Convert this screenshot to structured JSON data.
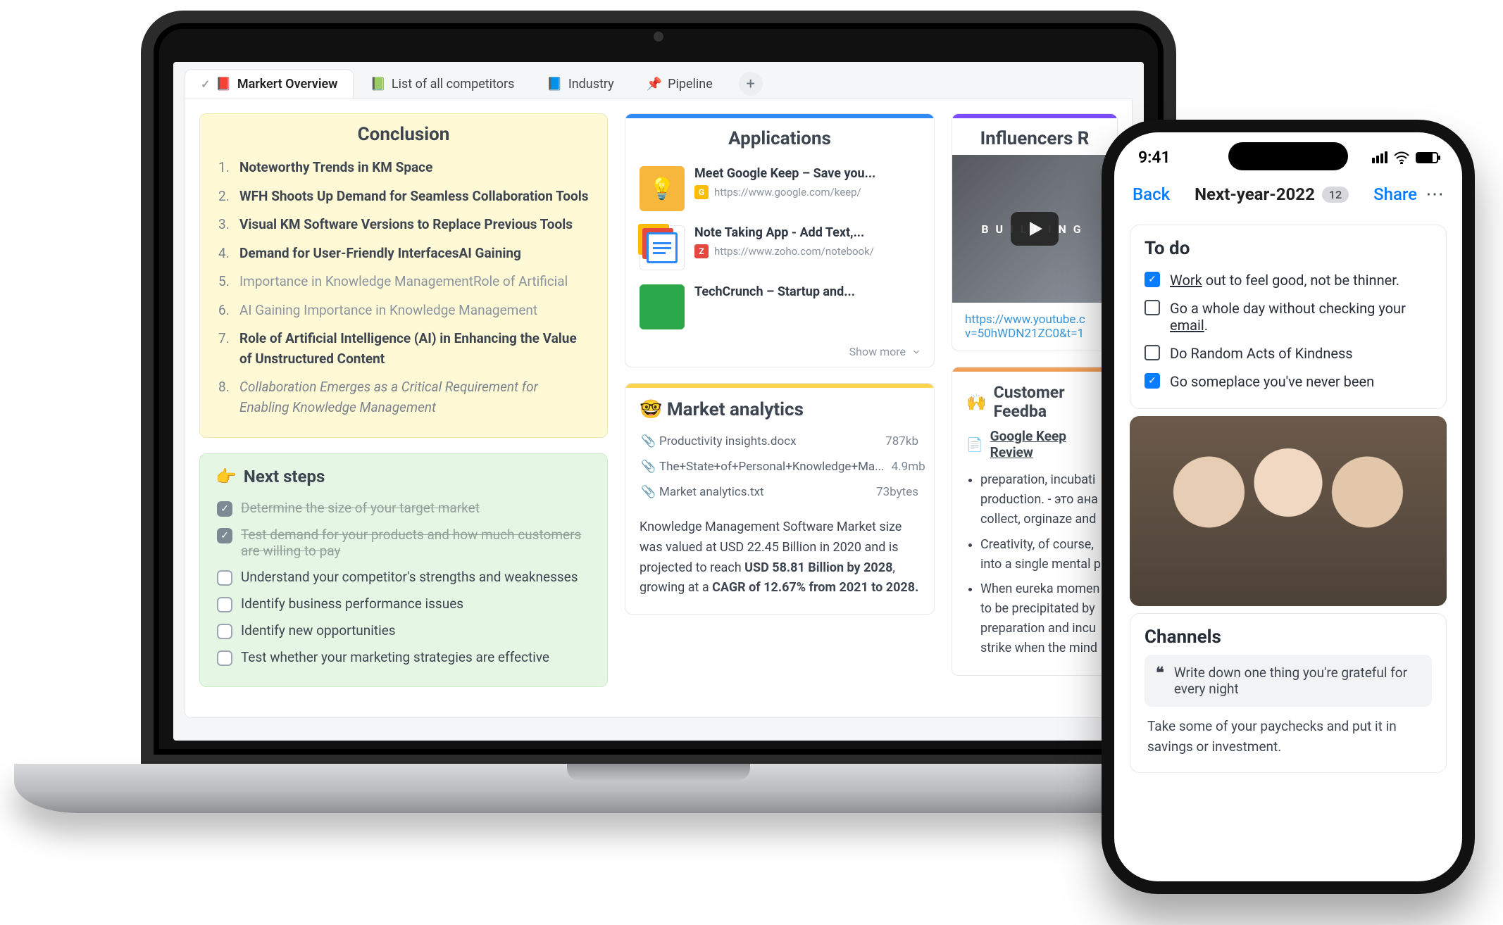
{
  "tabs": [
    {
      "emoji": "📕",
      "label": "Markert Overview",
      "active": true
    },
    {
      "emoji": "📗",
      "label": "List of all competitors"
    },
    {
      "emoji": "📘",
      "label": "Industry"
    },
    {
      "emoji": "📌",
      "label": "Pipeline"
    }
  ],
  "conclusion": {
    "title": "Conclusion",
    "items": [
      {
        "text": "Noteworthy Trends in KM Space",
        "style": "bold"
      },
      {
        "text": "WFH Shoots Up Demand for Seamless Collaboration Tools",
        "style": "bold"
      },
      {
        "text": "Visual KM Software Versions to Replace Previous Tools",
        "style": "bold"
      },
      {
        "text": "Demand for User-Friendly InterfacesAI Gaining",
        "style": "bold"
      },
      {
        "text": "Importance in Knowledge ManagementRole of Artificial",
        "style": "muted"
      },
      {
        "text": "AI Gaining Importance in Knowledge Management",
        "style": "muted"
      },
      {
        "text": "Role of Artificial Intelligence (AI) in Enhancing the Value of Unstructured Content",
        "style": "bold"
      },
      {
        "text": "Collaboration Emerges as a Critical Requirement for Enabling Knowledge Management",
        "style": "italic"
      }
    ]
  },
  "nextsteps": {
    "emoji": "👉",
    "title": "Next steps",
    "items": [
      {
        "text": "Determine the size of your target market",
        "done": true
      },
      {
        "text": "Test demand for your products and how much customers are willing to pay",
        "done": true
      },
      {
        "text": "Understand your competitor's strengths and weaknesses",
        "done": false
      },
      {
        "text": "Identify business performance issues",
        "done": false
      },
      {
        "text": "Identify new opportunities",
        "done": false
      },
      {
        "text": "Test whether your marketing strategies are effective",
        "done": false
      }
    ]
  },
  "applications": {
    "title": "Applications",
    "items": [
      {
        "title": "Meet Google Keep – Save you...",
        "url": "https://www.google.com/keep/",
        "fav_bg": "#fbbc05",
        "fav_txt": "G",
        "thumb_bg": "#f6b73c"
      },
      {
        "title": "Note Taking App - Add Text,...",
        "url": "https://www.zoho.com/notebook/",
        "fav_bg": "#e4483e",
        "fav_txt": "Z",
        "thumb_bg": "#2f8af5"
      },
      {
        "title": "TechCrunch – Startup and...",
        "url": "",
        "fav_bg": "#2aa84a",
        "fav_txt": "",
        "thumb_bg": "#2aa84a"
      }
    ],
    "show_more": "Show more"
  },
  "analytics": {
    "emoji": "🤓",
    "title": "Market analytics",
    "files": [
      {
        "name": "Productivity insights.docx",
        "size": "787kb"
      },
      {
        "name": "The+State+of+Personal+Knowledge+Ma...",
        "size": "4.9mb"
      },
      {
        "name": "Market analytics.txt",
        "size": "73bytes"
      }
    ],
    "body_pre": "Knowledge Management Software Market size was valued at USD 22.45 Billion in 2020 and is projected to reach ",
    "body_bold1": "USD 58.81 Billion by 2028",
    "body_mid": ", growing at a ",
    "body_bold2": "CAGR of 12.67% from 2021 to 2028."
  },
  "influencers": {
    "title": "Influencers R",
    "video_word": "BUILDING",
    "link": "https://www.youtube.c\nv=50hWDN21ZC0&t=1"
  },
  "feedback": {
    "emoji": "🙌",
    "title": "Customer Feedba",
    "link_label": "Google Keep Review",
    "bullets": [
      "preparation, incubati production. - это ана collect, orginaze and",
      "Creativity, of course, into a single mental p",
      "When eureka momen to be precipitated by preparation and incu strike when the mind"
    ]
  },
  "phone": {
    "time": "9:41",
    "back": "Back",
    "title": "Next-year-2022",
    "badge": "12",
    "share": "Share",
    "todo": {
      "title": "To do",
      "items": [
        {
          "text": "Work out to feel good, not be thinner.",
          "done": true,
          "u": "Work"
        },
        {
          "text": "Go a whole day without checking your email.",
          "done": false,
          "u": "email"
        },
        {
          "text": "Do Random Acts of Kindness",
          "done": false
        },
        {
          "text": "Go someplace you've never been",
          "done": true
        }
      ]
    },
    "channels": {
      "title": "Channels",
      "quote": "Write down one thing you're grateful for every night",
      "text": "Take some of your paychecks and put it in savings or investment."
    }
  }
}
